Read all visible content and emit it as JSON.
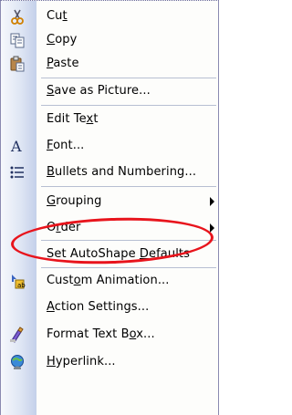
{
  "menu": {
    "items": [
      {
        "pre": "Cu",
        "acc": "t",
        "post": "",
        "icon": "scissors-icon"
      },
      {
        "pre": "",
        "acc": "C",
        "post": "opy",
        "icon": "copy-icon"
      },
      {
        "pre": "",
        "acc": "P",
        "post": "aste",
        "icon": "paste-icon"
      },
      {
        "pre": "",
        "acc": "S",
        "post": "ave as Picture...",
        "icon": ""
      },
      {
        "pre": "Edit Te",
        "acc": "x",
        "post": "t",
        "icon": ""
      },
      {
        "pre": "",
        "acc": "F",
        "post": "ont...",
        "icon": "font-icon"
      },
      {
        "pre": "",
        "acc": "B",
        "post": "ullets and Numbering...",
        "icon": "bullets-icon"
      },
      {
        "pre": "",
        "acc": "G",
        "post": "rouping",
        "icon": ""
      },
      {
        "pre": "O",
        "acc": "r",
        "post": "der",
        "icon": ""
      },
      {
        "pre": "Set AutoShape ",
        "acc": "D",
        "post": "efaults",
        "icon": ""
      },
      {
        "pre": "Cust",
        "acc": "o",
        "post": "m Animation...",
        "icon": "custom-animation-icon"
      },
      {
        "pre": "",
        "acc": "A",
        "post": "ction Settings...",
        "icon": ""
      },
      {
        "pre": "Format Text B",
        "acc": "o",
        "post": "x...",
        "icon": "format-text-box-icon"
      },
      {
        "pre": "",
        "acc": "H",
        "post": "yperlink...",
        "icon": "hyperlink-icon"
      }
    ]
  },
  "colors": {
    "highlight_ellipse": "#e8141c",
    "gutter_dark": "#c4d0ea"
  }
}
